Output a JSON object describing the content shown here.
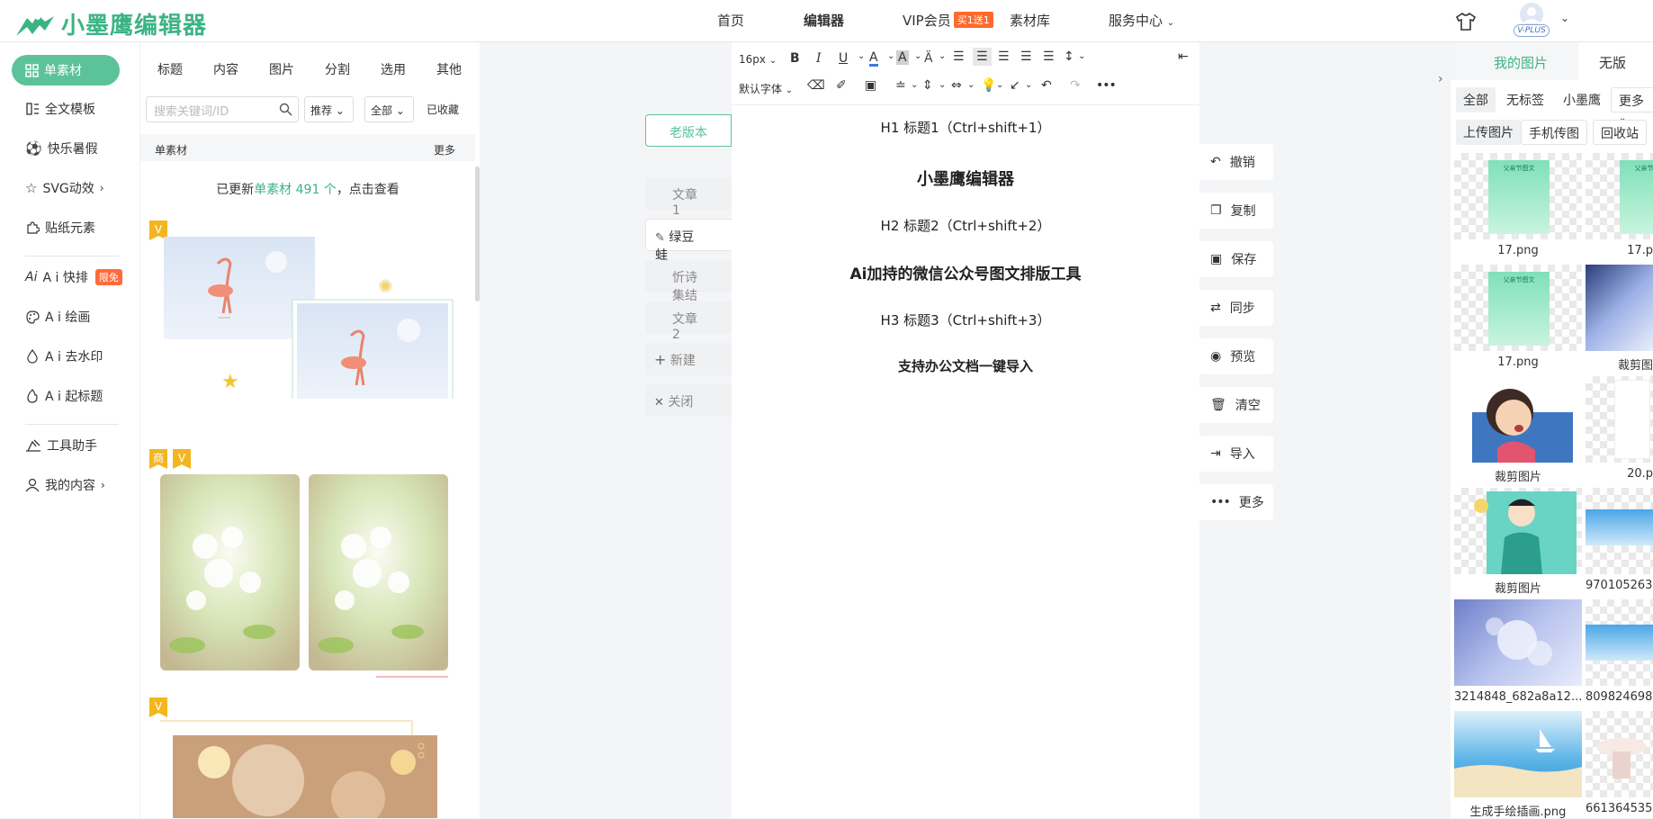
{
  "header": {
    "logo_text": "小墨鹰编辑器",
    "nav": [
      {
        "label": "首页"
      },
      {
        "label": "编辑器"
      },
      {
        "label": "VIP会员"
      },
      {
        "label": "素材库"
      },
      {
        "label": "服务中心"
      }
    ],
    "vip_badge": "买1送1",
    "avatar_badge": "V-PLUS"
  },
  "sidebar": {
    "items": [
      {
        "label": "单素材",
        "icon": "grid-icon"
      },
      {
        "label": "全文模板",
        "icon": "template-icon"
      },
      {
        "label": "快乐暑假",
        "icon": "ball-icon"
      },
      {
        "label": "SVG动效",
        "icon": "star-icon"
      },
      {
        "label": "贴纸元素",
        "icon": "puzzle-icon"
      },
      {
        "label": "A i 快排",
        "icon": "ai-icon",
        "badge": "限免"
      },
      {
        "label": "A i 绘画",
        "icon": "palette-icon"
      },
      {
        "label": "A i 去水印",
        "icon": "drop-icon"
      },
      {
        "label": "A i 起标题",
        "icon": "fire-icon"
      },
      {
        "label": "工具助手",
        "icon": "tool-icon"
      },
      {
        "label": "我的内容",
        "icon": "user-icon"
      }
    ]
  },
  "material": {
    "tabs": [
      "标题",
      "内容",
      "图片",
      "分割",
      "选用",
      "其他"
    ],
    "search_placeholder": "搜索关键词/ID",
    "sort": "推荐",
    "filter": "全部",
    "collected": "已收藏",
    "header_title": "单素材",
    "header_more": "更多",
    "update_prefix": "已更新",
    "update_highlight": "单素材 491 个",
    "update_suffix": "，点击查看",
    "badge_v": "V",
    "badge_shang": "商"
  },
  "doc_tabs": {
    "old_version": "老版本",
    "items": [
      "文章1",
      "绿豆蛙",
      "忻诗集结",
      "文章2"
    ],
    "new": "新建",
    "close": "关闭"
  },
  "editor": {
    "font_size": "16px",
    "font_family": "默认字体",
    "lines": [
      {
        "text": "H1 标题1（Ctrl+shift+1）"
      },
      {
        "text": "小墨鹰编辑器"
      },
      {
        "text": "H2 标题2（Ctrl+shift+2）"
      },
      {
        "text": "Ai加持的微信公众号图文排版工具"
      },
      {
        "text": "H3 标题3（Ctrl+shift+3）"
      },
      {
        "text": "支持办公文档一键导入"
      }
    ]
  },
  "side_actions": [
    "撤销",
    "复制",
    "保存",
    "同步",
    "预览",
    "清空",
    "导入",
    "更多"
  ],
  "right_panel": {
    "tabs": [
      "我的图片",
      "无版"
    ],
    "filters": [
      "全部",
      "无标签",
      "小墨鹰",
      "更多"
    ],
    "actions": [
      "上传图片",
      "手机传图",
      "回收站"
    ],
    "images": [
      {
        "label": "17.png"
      },
      {
        "label": "17.p"
      },
      {
        "label": "17.png"
      },
      {
        "label": "裁剪图"
      },
      {
        "label": "裁剪图片"
      },
      {
        "label": "20.p"
      },
      {
        "label": "裁剪图片"
      },
      {
        "label": "970105263"
      },
      {
        "label": "3214848_682a8a12..."
      },
      {
        "label": "809824698"
      },
      {
        "label": "生成手绘插画.png"
      },
      {
        "label": "661364535"
      }
    ],
    "thumb_headline": "父亲节图文"
  }
}
